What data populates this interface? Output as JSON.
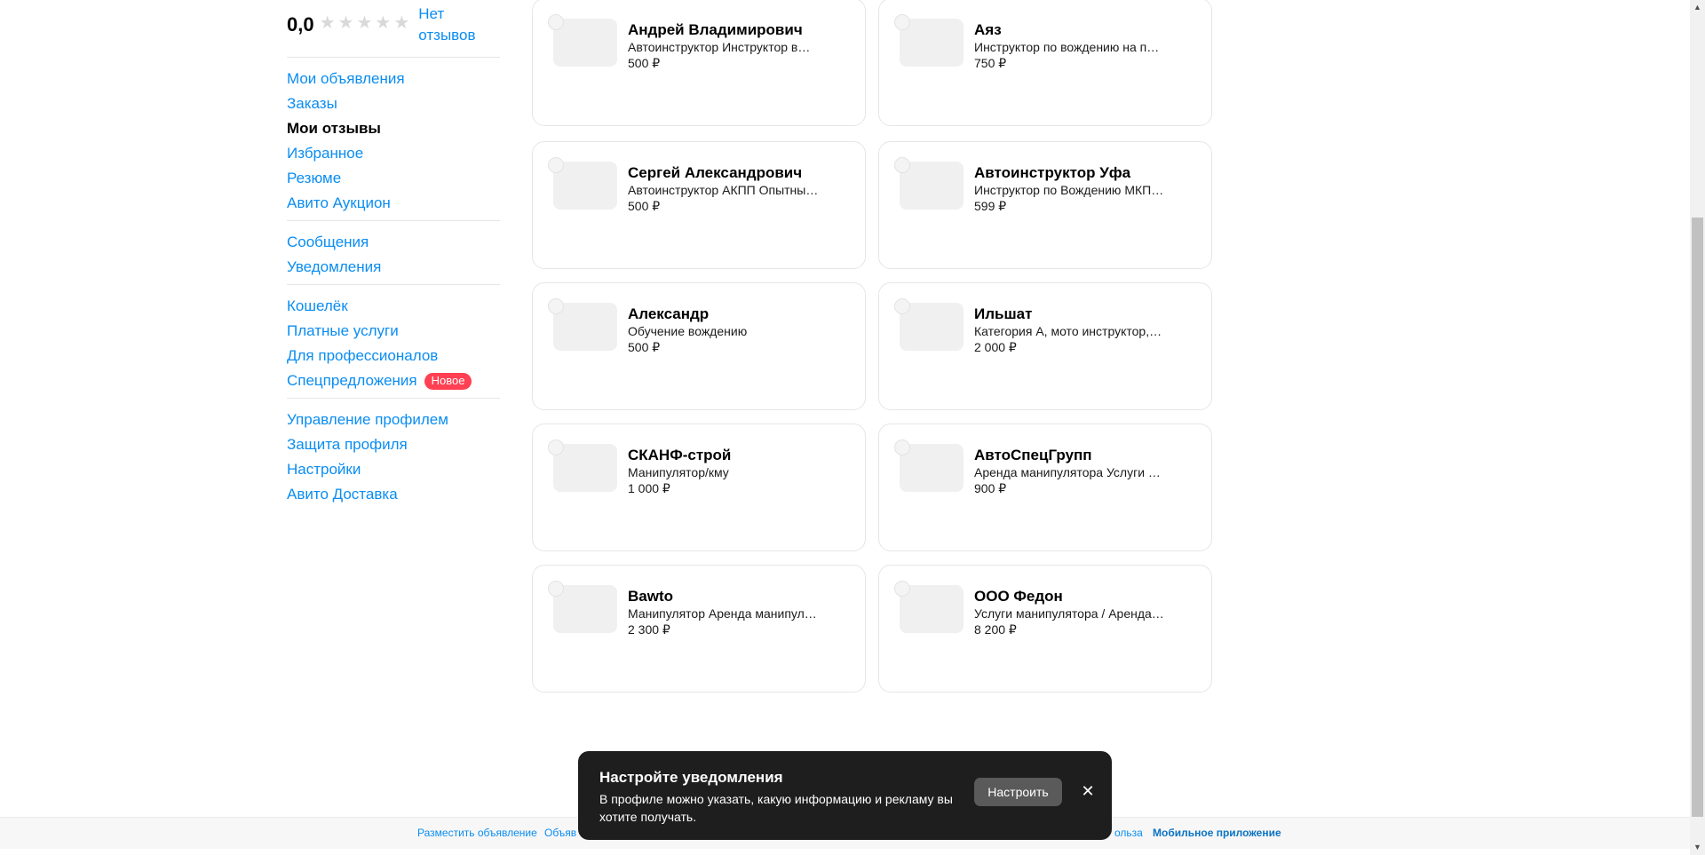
{
  "sidebar": {
    "rating": {
      "score": "0,0",
      "stars_filled": 0,
      "stars_total": 5,
      "no_reviews": "Нет отзывов"
    },
    "groups": [
      {
        "items": [
          {
            "label": "Мои объявления",
            "active": false
          },
          {
            "label": "Заказы",
            "active": false
          },
          {
            "label": "Мои отзывы",
            "active": true
          },
          {
            "label": "Избранное",
            "active": false
          },
          {
            "label": "Резюме",
            "active": false
          },
          {
            "label": "Авито Аукцион",
            "active": false
          }
        ]
      },
      {
        "items": [
          {
            "label": "Сообщения",
            "active": false
          },
          {
            "label": "Уведомления",
            "active": false
          }
        ]
      },
      {
        "items": [
          {
            "label": "Кошелёк",
            "active": false
          },
          {
            "label": "Платные услуги",
            "active": false
          },
          {
            "label": "Для профессионалов",
            "active": false
          },
          {
            "label": "Спецпредложения",
            "active": false,
            "badge": "Новое"
          }
        ]
      },
      {
        "items": [
          {
            "label": "Управление профилем",
            "active": false
          },
          {
            "label": "Защита профиля",
            "active": false
          },
          {
            "label": "Настройки",
            "active": false
          },
          {
            "label": "Авито Доставка",
            "active": false
          }
        ]
      }
    ]
  },
  "cards": [
    {
      "name": "Андрей Владимирович",
      "desc": "Автоинструктор Инструктор в…",
      "price": "500 ₽"
    },
    {
      "name": "Аяз",
      "desc": "Инструктор по вождению на п…",
      "price": "750 ₽"
    },
    {
      "name": "Сергей Александрович",
      "desc": "Автоинструктор АКПП Опытны…",
      "price": "500 ₽"
    },
    {
      "name": "Автоинструктор Уфа",
      "desc": "Инструктор по Вождению МКП…",
      "price": "599 ₽"
    },
    {
      "name": "Александр",
      "desc": "Обучение вождению",
      "price": "500 ₽"
    },
    {
      "name": "Ильшат",
      "desc": "Категория А, мото инструктор,…",
      "price": "2 000 ₽"
    },
    {
      "name": "СКАНФ-строй",
      "desc": "Манипулятор/кму",
      "price": "1 000 ₽"
    },
    {
      "name": "АвтоСпецГрупп",
      "desc": "Аренда манипулятора Услуги …",
      "price": "900 ₽"
    },
    {
      "name": "Bawto",
      "desc": "Манипулятор Аренда манипул…",
      "price": "2 300 ₽"
    },
    {
      "name": "ООО Федон",
      "desc": "Услуги манипулятора / Аренда…",
      "price": "8 200 ₽"
    }
  ],
  "footer": {
    "links": [
      {
        "label": "Разместить объявление",
        "bold": false
      },
      {
        "label": "Объяв",
        "bold": false
      },
      {
        "label": "ольза",
        "bold": false
      },
      {
        "label": "Мобильное приложение",
        "bold": true
      }
    ]
  },
  "toast": {
    "title": "Настройте уведомления",
    "text": "В профиле можно указать, какую информацию и рекламу вы хотите получать.",
    "button": "Настроить",
    "close_icon": "close-icon"
  },
  "colors": {
    "link": "#0a8df2",
    "badge": "#ff4053",
    "toast_bg": "#1e1e1e",
    "toast_button": "#5a5a5a"
  }
}
